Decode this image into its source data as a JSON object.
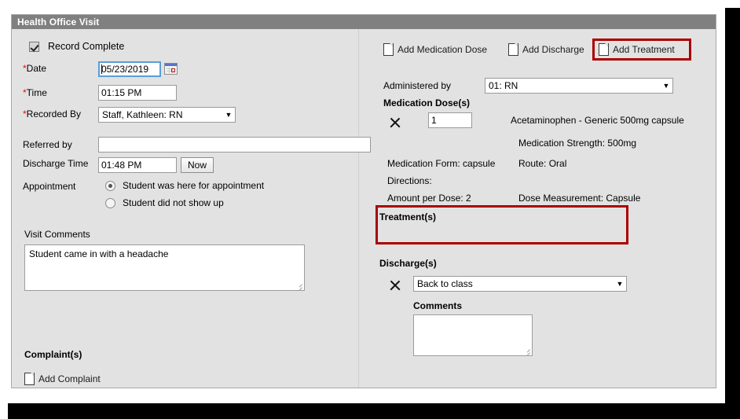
{
  "window": {
    "title": "Health Office Visit"
  },
  "left": {
    "record_complete": {
      "label": "Record Complete",
      "checked": true
    },
    "date": {
      "label": "Date",
      "required": true,
      "value": "05/23/2019",
      "calendar_icon": "calendar-icon"
    },
    "time": {
      "label": "Time",
      "required": true,
      "value": "01:15 PM"
    },
    "recorded_by": {
      "label": "Recorded By",
      "required": true,
      "value": "Staff, Kathleen: RN"
    },
    "referred_by": {
      "label": "Referred by",
      "required": false,
      "value": "",
      "placeholder": ""
    },
    "discharge_time": {
      "label": "Discharge Time",
      "value": "01:48 PM",
      "now_button": "Now"
    },
    "appointment": {
      "label": "Appointment",
      "options": [
        {
          "label": "Student was here for appointment",
          "selected": true
        },
        {
          "label": "Student did not show up",
          "selected": false
        }
      ]
    },
    "visit_comments": {
      "label": "Visit Comments",
      "value": "Student came in with a headache"
    },
    "complaints": {
      "section_title": "Complaint(s)",
      "add_label": "Add Complaint",
      "add_icon": "page-icon"
    }
  },
  "right": {
    "actions": [
      {
        "label": "Add Medication Dose",
        "icon": "page-icon",
        "highlighted": false
      },
      {
        "label": "Add Discharge",
        "icon": "page-icon",
        "highlighted": false
      },
      {
        "label": "Add Treatment",
        "icon": "page-icon",
        "highlighted": true
      }
    ],
    "administered_by": {
      "label": "Administered by",
      "value": "01: RN"
    },
    "medication_doses": {
      "section_title": "Medication Dose(s)",
      "delete_icon": "x-icon",
      "quantity": "1",
      "name": "Acetaminophen - Generic 500mg capsule",
      "strength": "Medication Strength: 500mg",
      "form": "Medication Form: capsule",
      "route": "Route: Oral",
      "directions": "Directions:",
      "amount_per_dose": "Amount per Dose: 2",
      "dose_measurement": "Dose Measurement: Capsule"
    },
    "treatments": {
      "section_title": "Treatment(s)",
      "highlighted": true
    },
    "discharges": {
      "section_title": "Discharge(s)",
      "delete_icon": "x-icon",
      "selected": "Back to class",
      "comments_label": "Comments",
      "comments_value": ""
    }
  },
  "colors": {
    "titlebar": "#808080",
    "panel": "#e2e2e2",
    "required_star": "#e01010",
    "highlight": "#aa0000",
    "focus": "#5b9dd9"
  }
}
